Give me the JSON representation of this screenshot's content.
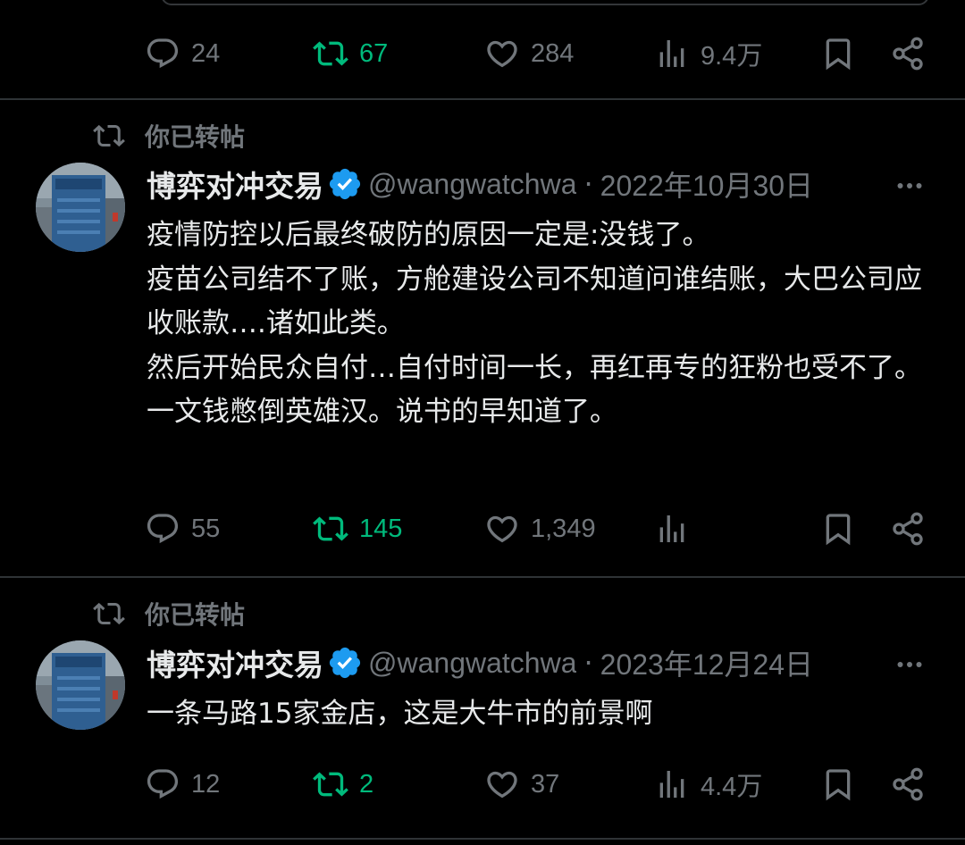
{
  "tweets": [
    {
      "stats": {
        "replies": "24",
        "reposts": "67",
        "likes": "284",
        "views": "9.4万"
      }
    },
    {
      "repost_label": "你已转帖",
      "author": {
        "name": "博弈对冲交易",
        "handle": "@wangwatchwa"
      },
      "separator": "·",
      "date": "2022年10月30日",
      "body": [
        "疫情防控以后最终破防的原因一定是:没钱了。",
        "疫苗公司结不了账，方舱建设公司不知道问谁结账，大巴公司应收账款….诸如此类。",
        "然后开始民众自付…自付时间一长，再红再专的狂粉也受不了。",
        "一文钱憋倒英雄汉。说书的早知道了。"
      ],
      "stats": {
        "replies": "55",
        "reposts": "145",
        "likes": "1,349",
        "views": ""
      }
    },
    {
      "repost_label": "你已转帖",
      "author": {
        "name": "博弈对冲交易",
        "handle": "@wangwatchwa"
      },
      "separator": "·",
      "date": "2023年12月24日",
      "body": [
        "一条马路15家金店，这是大牛市的前景啊"
      ],
      "stats": {
        "replies": "12",
        "reposts": "2",
        "likes": "37",
        "views": "4.4万"
      }
    }
  ],
  "icons": {
    "reply": "speech-bubble",
    "repost": "repost-arrows",
    "like": "heart",
    "views": "bar-chart",
    "bookmark": "bookmark",
    "share": "share-nodes",
    "verified": "verified-badge",
    "more": "three-dots"
  },
  "colors": {
    "background": "#000000",
    "text": "#e7e9ea",
    "muted": "#71767b",
    "repost_active": "#00ba7c",
    "verified": "#1d9bf0",
    "divider": "#2f3336"
  }
}
